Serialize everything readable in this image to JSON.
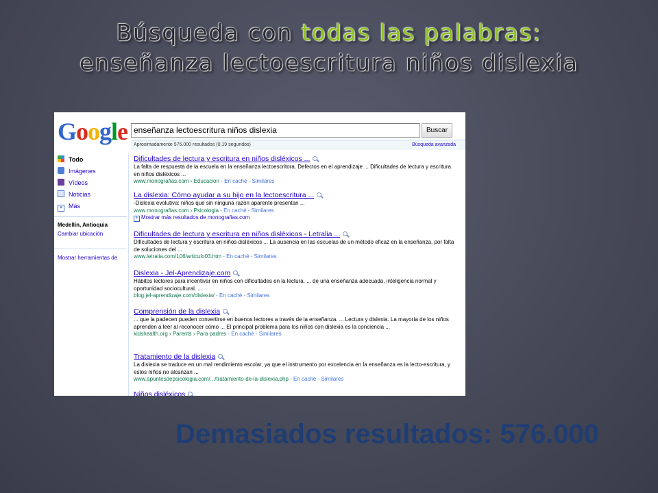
{
  "slide": {
    "title_part1": "Búsqueda con ",
    "title_highlight": "todas las palabras",
    "title_colon": ":",
    "title_line2": "enseñanza lectoescritura niños dislexia",
    "caption": "Demasiados resultados: 576.000",
    "highlight_color": "#8ec21f"
  },
  "screenshot": {
    "logo": [
      "G",
      "o",
      "o",
      "g",
      "l",
      "e"
    ],
    "search_query": "enseñanza lectoescritura niños dislexia",
    "search_button": "Buscar",
    "stats": "Aproximadamente 576.000 resultados (0,19 segundos)",
    "advanced_search": "Búsqueda avanzada",
    "sidebar": {
      "items": [
        {
          "label": "Todo",
          "icon": "all-results-icon",
          "color": "#4285f4"
        },
        {
          "label": "Imágenes",
          "icon": "images-icon",
          "color": "#4e7fd6"
        },
        {
          "label": "Vídeos",
          "icon": "videos-icon",
          "color": "#6b3fa0"
        },
        {
          "label": "Noticias",
          "icon": "news-icon",
          "color": "#3b7ad6"
        },
        {
          "label": "Más",
          "icon": "more-icon",
          "color": "#3b68c4"
        }
      ],
      "location": "Medellín, Antioquia",
      "change_location": "Cambiar ubicación",
      "show_tools": "Mostrar herramientas de"
    },
    "results": [
      {
        "title": "Dificultades de lectura y escritura en niños disléxicos ...",
        "snippet": "La falta de respuesta de la escuela en la enseñanza lectoescritora. Defectos en el aprendizaje ... Dificultades de lectura y escritura en niños disléxicos ...",
        "url": "www.monografias.com › Educacion",
        "cache": " - En caché - Similares"
      },
      {
        "title": "La dislexia: Cómo ayudar a su hijo en la lectoescritura ...",
        "snippet": "-Dislexia evolutiva: niños que sin ninguna razón aparente presentan ...",
        "url": "www.monografias.com › Psicologia",
        "cache": " - En caché - Similares",
        "more": "Mostrar más resultados de monografias.com"
      },
      {
        "title": "Dificultades de lectura y escritura en niños disléxicos - Letralia ...",
        "snippet": "Dificultades de lectura y escritura en niños disléxicos ... La ausencia en las escuelas de un método eficaz en la enseñanza, por falta de soluciones del ...",
        "url": "www.letralia.com/106/articulo03.htm",
        "cache": " - En caché - Similares"
      },
      {
        "title": "Dislexia - Jel-Aprendizaje.com",
        "snippet": "Hábitos lectores para incentivar en niños con dificultades en la lectura. ... de una enseñanza adecuada, inteligencia normal y oportunidad sociocultural. ...",
        "url": "blog.jel-aprendizaje.com/dislexia/",
        "cache": " - En caché - Similares"
      },
      {
        "title": "Comprensión de la dislexia",
        "snippet": "... que la padecen pueden convertirse en buenos lectores a través de la enseñanza. ... Lectura y dislexia. La mayoría de los niños aprenden a leer al reconocer cómo ... El principal problema para los niños con dislexia es la conciencia ...",
        "url": "kidshealth.org › Parents › Para padres",
        "cache": " - En caché - Similares"
      },
      {
        "title": "Tratamiento de la dislexia",
        "snippet": "La dislexia se traduce en un mal rendimiento escolar, ya que el instrumento por excelencia en la enseñanza es la lecto-escritura, y estos niños no alcanzan ...",
        "url": "www.apuntesdepsicologia.com/.../tratamiento-de-la-dislexia.php",
        "cache": " - En caché - Similares"
      },
      {
        "title": "Niños disléxicos",
        "snippet": "",
        "url": "",
        "cache": ""
      }
    ]
  }
}
